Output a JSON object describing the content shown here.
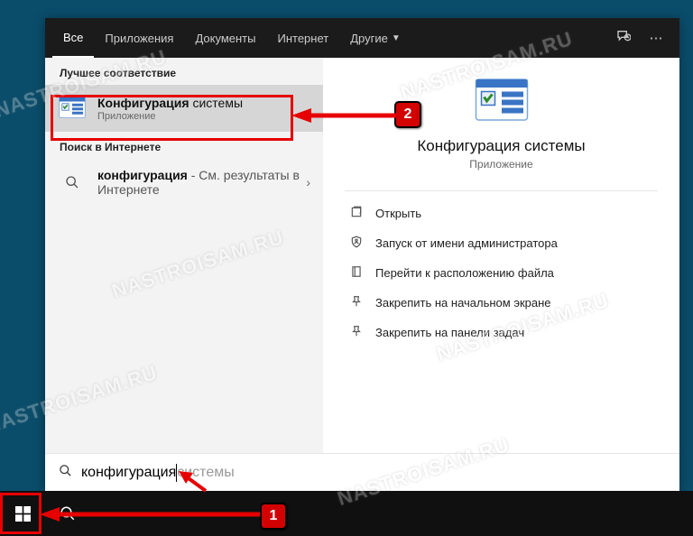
{
  "tabs": {
    "items": [
      "Все",
      "Приложения",
      "Документы",
      "Интернет",
      "Другие"
    ],
    "active_index": 0
  },
  "sections": {
    "best_match": "Лучшее соответствие",
    "web": "Поиск в Интернете"
  },
  "best_match_result": {
    "title_bold": "Конфигурация",
    "title_rest": " системы",
    "subtitle": "Приложение"
  },
  "web_result": {
    "title_bold": "конфигурация",
    "title_rest": " - См. результаты в Интернете"
  },
  "preview": {
    "title": "Конфигурация системы",
    "subtitle": "Приложение",
    "actions": [
      {
        "icon": "open",
        "label": "Открыть"
      },
      {
        "icon": "admin",
        "label": "Запуск от имени администратора"
      },
      {
        "icon": "location",
        "label": "Перейти к расположению файла"
      },
      {
        "icon": "pin-start",
        "label": "Закрепить на начальном экране"
      },
      {
        "icon": "pin-task",
        "label": "Закрепить на панели задач"
      }
    ]
  },
  "search": {
    "typed": "конфигурация",
    "suggestion": " системы"
  },
  "annotations": {
    "badge1": "1",
    "badge2": "2"
  },
  "watermark": "NASTROISAM.RU"
}
